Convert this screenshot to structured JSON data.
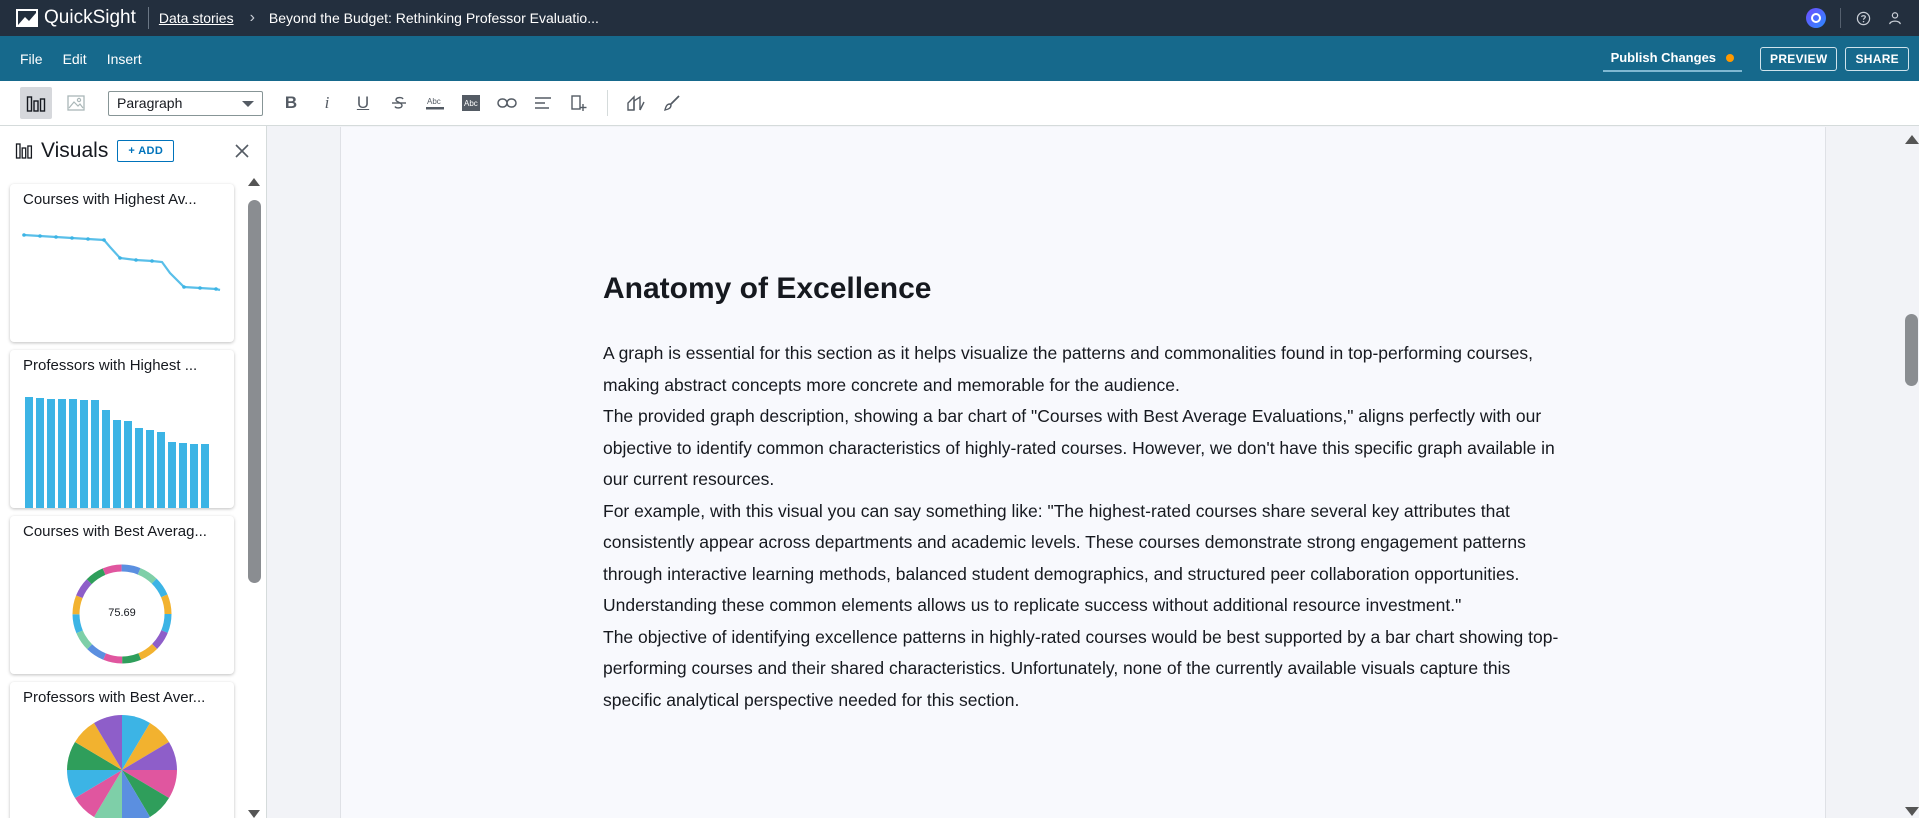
{
  "topbar": {
    "app_name": "QuickSight",
    "breadcrumb_link": "Data stories",
    "breadcrumb_title": "Beyond the Budget: Rethinking Professor Evaluatio..."
  },
  "menubar": {
    "file": "File",
    "edit": "Edit",
    "insert": "Insert",
    "publish": "Publish Changes",
    "preview": "PREVIEW",
    "share": "SHARE"
  },
  "toolbar": {
    "paragraph_style": "Paragraph",
    "bold": "B",
    "italic": "i",
    "underline": "U"
  },
  "panel": {
    "title": "Visuals",
    "add_label": "+ ADD",
    "cards": [
      {
        "title": "Courses with Highest Av...",
        "kind": "line"
      },
      {
        "title": "Professors with Highest ...",
        "kind": "bar"
      },
      {
        "title": "Courses with Best Averag...",
        "kind": "donut",
        "center_value": "75.69"
      },
      {
        "title": "Professors with Best Aver...",
        "kind": "pie"
      }
    ]
  },
  "story": {
    "title": "Anatomy of Excellence",
    "paragraphs": [
      "A graph is essential for this section as it helps visualize the patterns and commonalities found in top-performing courses, making abstract concepts more concrete and memorable for the audience.",
      "The provided graph description, showing a bar chart of \"Courses with Best Average Evaluations,\" aligns perfectly with our objective to identify common characteristics of highly-rated courses. However, we don't have this specific graph available in our current resources.",
      "For example, with this visual you can say something like: \"The highest-rated courses share several key attributes that consistently appear across departments and academic levels. These courses demonstrate strong engagement patterns through interactive learning methods, balanced student demographics, and structured peer collaboration opportunities. Understanding these common elements allows us to replicate success without additional resource investment.\"",
      "The objective of identifying excellence patterns in highly-rated courses would be best supported by a bar chart showing top-performing courses and their shared characteristics. Unfortunately, none of the currently available visuals capture this specific analytical perspective needed for this section."
    ]
  },
  "colors": {
    "topbar": "#232f3e",
    "menubar": "#16698c",
    "accent": "#0073bb",
    "publish_dot": "#ff9900",
    "thumb_series": "#3cb4e5"
  }
}
